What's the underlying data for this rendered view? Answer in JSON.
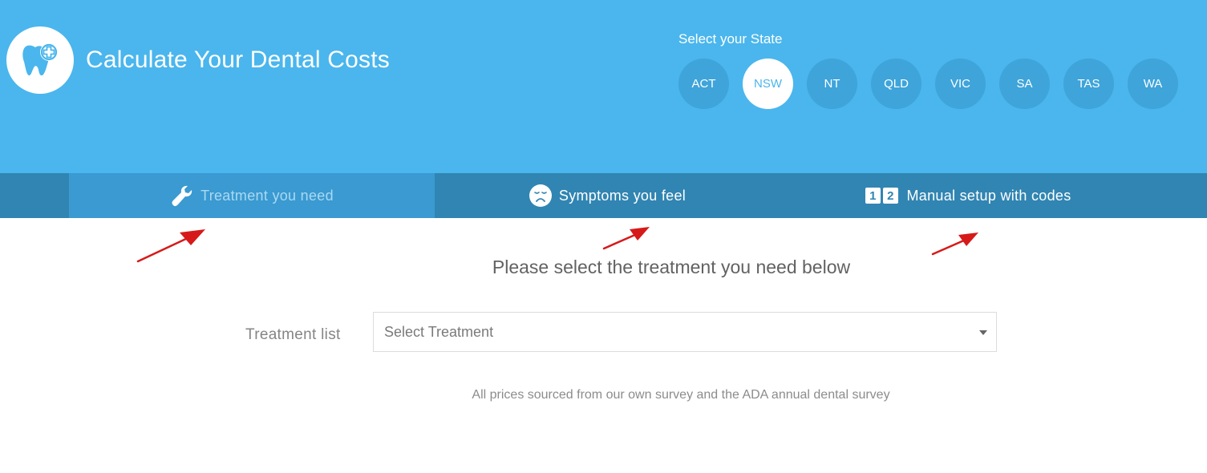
{
  "header": {
    "title": "Calculate Your Dental Costs",
    "logo_icon": "tooth-plus-icon",
    "state_selector": {
      "label": "Select your State",
      "selected": "NSW",
      "states": [
        "ACT",
        "NSW",
        "NT",
        "QLD",
        "VIC",
        "SA",
        "TAS",
        "WA"
      ]
    }
  },
  "tabs": [
    {
      "label": "Treatment you need",
      "icon": "wrench-icon",
      "active": true
    },
    {
      "label": "Symptoms you feel",
      "icon": "sad-face-icon",
      "active": false
    },
    {
      "label": "Manual setup with codes",
      "icon": "numbers-1-2-icon",
      "active": false
    }
  ],
  "main": {
    "instruction": "Please select the treatment you need below",
    "treatment_field": {
      "label": "Treatment list",
      "placeholder": "Select Treatment",
      "value": ""
    },
    "footnote": "All prices sourced from our own survey and the ADA annual dental survey"
  },
  "annotations": {
    "arrow_color": "#d61a1a",
    "arrow_count": 3
  },
  "colors": {
    "header_bg": "#4ab6ed",
    "state_btn_bg": "#3ea4da",
    "tabbar_bg": "#3185b2",
    "tab_active_bg": "#3a9ad1"
  }
}
